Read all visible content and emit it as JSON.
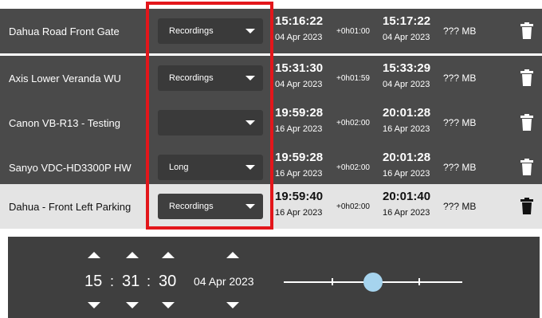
{
  "clips": [
    {
      "camera": "Dahua Road Front Gate",
      "type": "Recordings",
      "start_time": "15:16:22",
      "start_date": "04 Apr 2023",
      "duration": "+0h01:00",
      "end_time": "15:17:22",
      "end_date": "04 Apr 2023",
      "size": "??? MB",
      "selected": false
    },
    {
      "camera": "Axis Lower Veranda WU",
      "type": "Recordings",
      "start_time": "15:31:30",
      "start_date": "04 Apr 2023",
      "duration": "+0h01:59",
      "end_time": "15:33:29",
      "end_date": "04 Apr 2023",
      "size": "??? MB",
      "selected": false
    },
    {
      "camera": "Canon VB-R13 - Testing",
      "type": "",
      "start_time": "19:59:28",
      "start_date": "16 Apr 2023",
      "duration": "+0h02:00",
      "end_time": "20:01:28",
      "end_date": "16 Apr 2023",
      "size": "??? MB",
      "selected": false
    },
    {
      "camera": "Sanyo VDC-HD3300P HW",
      "type": "Long",
      "start_time": "19:59:28",
      "start_date": "16 Apr 2023",
      "duration": "+0h02:00",
      "end_time": "20:01:28",
      "end_date": "16 Apr 2023",
      "size": "??? MB",
      "selected": false
    },
    {
      "camera": "Dahua - Front Left Parking",
      "type": "Recordings",
      "start_time": "19:59:40",
      "start_date": "16 Apr 2023",
      "duration": "+0h02:00",
      "end_time": "20:01:40",
      "end_date": "16 Apr 2023",
      "size": "??? MB",
      "selected": true
    }
  ],
  "time_editor": {
    "hours": "15",
    "minutes": "31",
    "seconds": "30",
    "separator": ":",
    "date": "04 Apr 2023",
    "slider_position": 0.5
  },
  "icons": {
    "type_dropdown": "chevron-down-icon",
    "delete": "trash-icon",
    "increment": "arrow-up-icon",
    "decrement": "arrow-down-icon"
  },
  "colors": {
    "row_background": "#4a4a4a",
    "selected_row_background": "#e4e4e4",
    "dropdown_background": "#3a3a3a",
    "highlight_border": "#e3161b",
    "editor_background": "#3f3f3f",
    "slider_thumb": "#a6d4ee"
  }
}
